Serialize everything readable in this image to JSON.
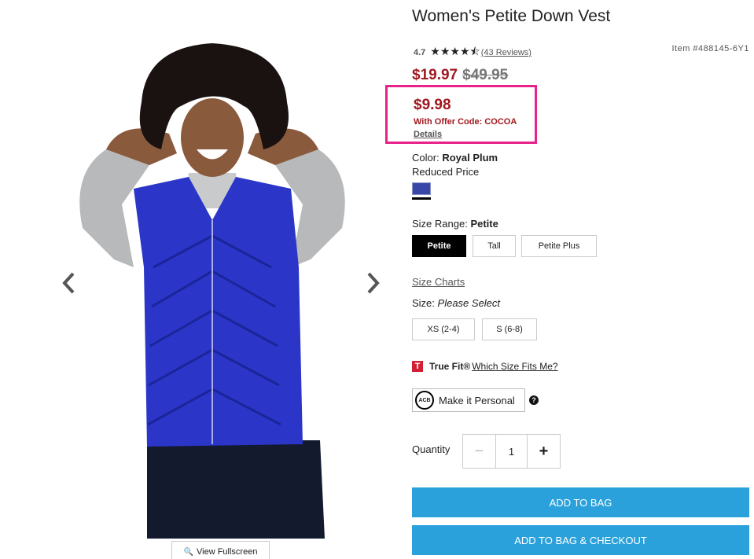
{
  "gallery": {
    "fullscreen_label": "View Fullscreen"
  },
  "product": {
    "title": "Women's Petite Down Vest",
    "rating": "4.7",
    "stars": "★★★★⯪",
    "reviews": "(43 Reviews)",
    "item_number": "Item #488145-6Y1",
    "sale_price": "$19.97",
    "original_price": "$49.95",
    "offer": {
      "price": "$9.98",
      "code_text": "With Offer Code: COCOA",
      "details": "Details"
    },
    "color_label": "Color:",
    "color_value": "Royal Plum",
    "reduced_price": "Reduced Price",
    "swatch_color": "#3846a8",
    "size_range_label": "Size Range:",
    "size_range_value": "Petite",
    "size_ranges": [
      "Petite",
      "Tall",
      "Petite Plus"
    ],
    "size_charts": "Size Charts",
    "size_label": "Size:",
    "size_value": "Please Select",
    "sizes": [
      "XS (2-4)",
      "S (6-8)"
    ],
    "truefit_name": "True Fit®",
    "truefit_link": "Which Size Fits Me?",
    "personal_label": "Make it Personal",
    "monogram_text": "ACB",
    "quantity_label": "Quantity",
    "quantity": "1",
    "add_to_bag": "ADD TO BAG",
    "add_to_bag_checkout": "ADD TO BAG & CHECKOUT"
  },
  "colors": {
    "sale": "#a0181f",
    "highlight": "#e8228a",
    "cta": "#2aa1db"
  }
}
